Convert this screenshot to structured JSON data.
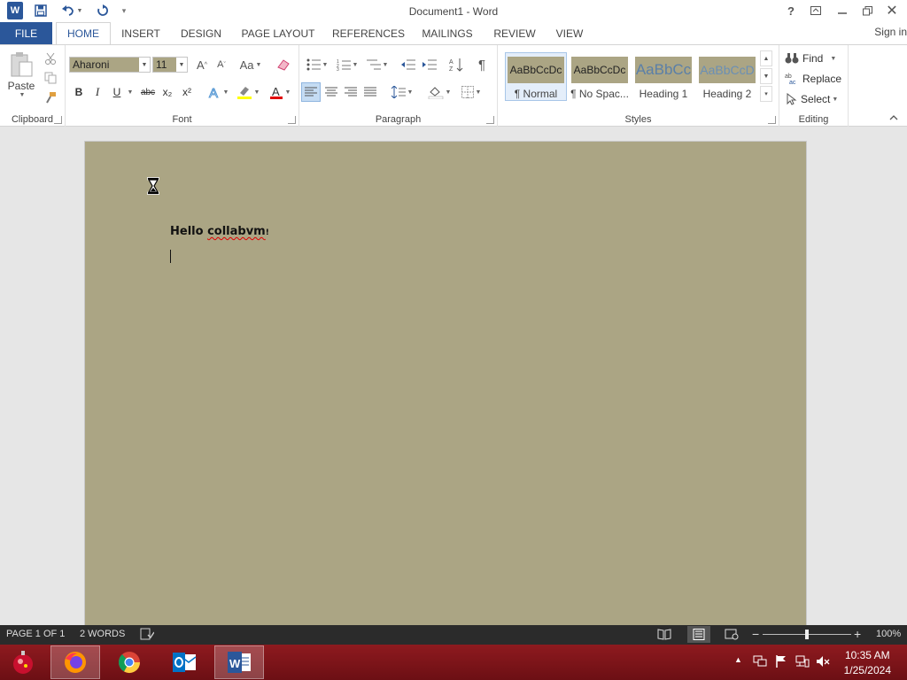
{
  "window": {
    "title": "Document1 - Word",
    "help": "?",
    "app_icon_letter": "W"
  },
  "tabs": {
    "file": "FILE",
    "items": [
      "HOME",
      "INSERT",
      "DESIGN",
      "PAGE LAYOUT",
      "REFERENCES",
      "MAILINGS",
      "REVIEW",
      "VIEW"
    ],
    "active": "HOME",
    "signin": "Sign in"
  },
  "ribbon": {
    "clipboard": {
      "label": "Clipboard",
      "paste": "Paste"
    },
    "font": {
      "label": "Font",
      "font_name": "Aharoni",
      "font_size": "11",
      "change_case": "Aa",
      "bold": "B",
      "italic": "I",
      "underline": "U",
      "strikethrough": "abc",
      "subscript": "x₂",
      "superscript": "x²"
    },
    "paragraph": {
      "label": "Paragraph"
    },
    "styles": {
      "label": "Styles",
      "items": [
        {
          "sample": "AaBbCcDc",
          "name": "¶ Normal",
          "color": "#222222",
          "selected": true
        },
        {
          "sample": "AaBbCcDc",
          "name": "¶ No Spac...",
          "color": "#222222",
          "selected": false
        },
        {
          "sample": "AaBbCc",
          "name": "Heading 1",
          "color": "#5a7fa8",
          "selected": false
        },
        {
          "sample": "AaBbCcD",
          "name": "Heading 2",
          "color": "#6a8fb5",
          "selected": false
        }
      ]
    },
    "editing": {
      "label": "Editing",
      "find": "Find",
      "replace": "Replace",
      "select": "Select"
    }
  },
  "document": {
    "text_word1": "Hello",
    "text_word2": "collabvm",
    "text_punct": "!"
  },
  "statusbar": {
    "page": "PAGE 1 OF 1",
    "words": "2 WORDS",
    "zoom": "100%",
    "zoom_fraction": 0.5
  },
  "taskbar": {
    "time": "10:35 AM",
    "date": "1/25/2024"
  },
  "colors": {
    "accent": "#2b579a",
    "page_background": "#aba584",
    "taskbar": "#8e1a1f"
  }
}
